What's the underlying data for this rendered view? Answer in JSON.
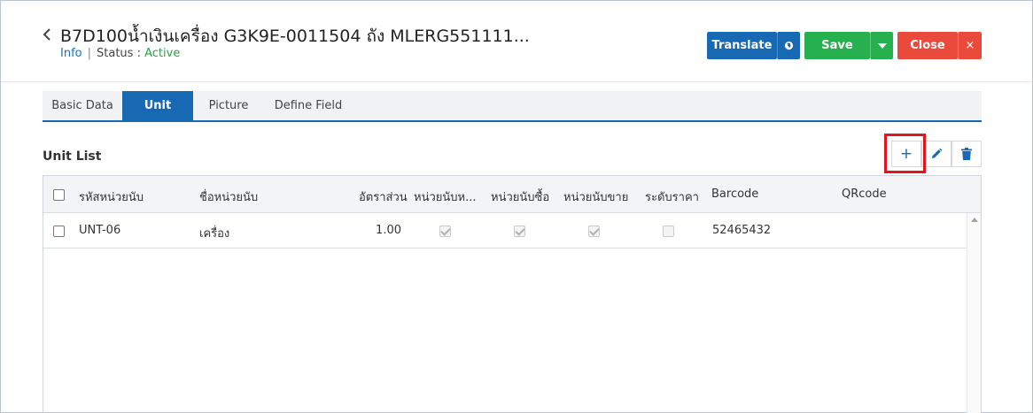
{
  "header": {
    "title": "B7D100น้ำเงินเครื่อง G3K9E-0011504 ถัง MLERG551111...",
    "info_label": "Info",
    "status_label": "Status",
    "status_colon": ":",
    "status_value": "Active",
    "separator": "|"
  },
  "actions": {
    "translate": "Translate",
    "save": "Save",
    "close": "Close",
    "close_x": "×"
  },
  "tabs": [
    {
      "label": "Basic Data",
      "active": false
    },
    {
      "label": "Unit",
      "active": true
    },
    {
      "label": "Picture",
      "active": false
    },
    {
      "label": "Define Field",
      "active": false
    }
  ],
  "unit_list": {
    "title": "Unit List",
    "add_label": "+",
    "columns": [
      "รหัสหน่วยนับ",
      "ชื่อหน่วยนับ",
      "อัตราส่วน",
      "หน่วยนับห...",
      "หน่วยนับซื้อ",
      "หน่วยนับขาย",
      "ระดับราคา",
      "Barcode",
      "QRcode"
    ],
    "rows": [
      {
        "code": "UNT-06",
        "name": "เครื่อง",
        "ratio": "1.00",
        "flag1": true,
        "flag2": true,
        "flag3": true,
        "price_level": false,
        "barcode": "52465432",
        "qrcode": ""
      }
    ]
  },
  "colors": {
    "primary": "#1769b4",
    "success": "#27b14e",
    "danger": "#e94a3c",
    "active_status": "#2fa04a",
    "highlight": "#e2151e"
  },
  "icons": [
    "chevron-left-icon",
    "globe-icon",
    "caret-down-icon",
    "close-icon",
    "plus-icon",
    "pencil-icon",
    "trash-icon"
  ]
}
